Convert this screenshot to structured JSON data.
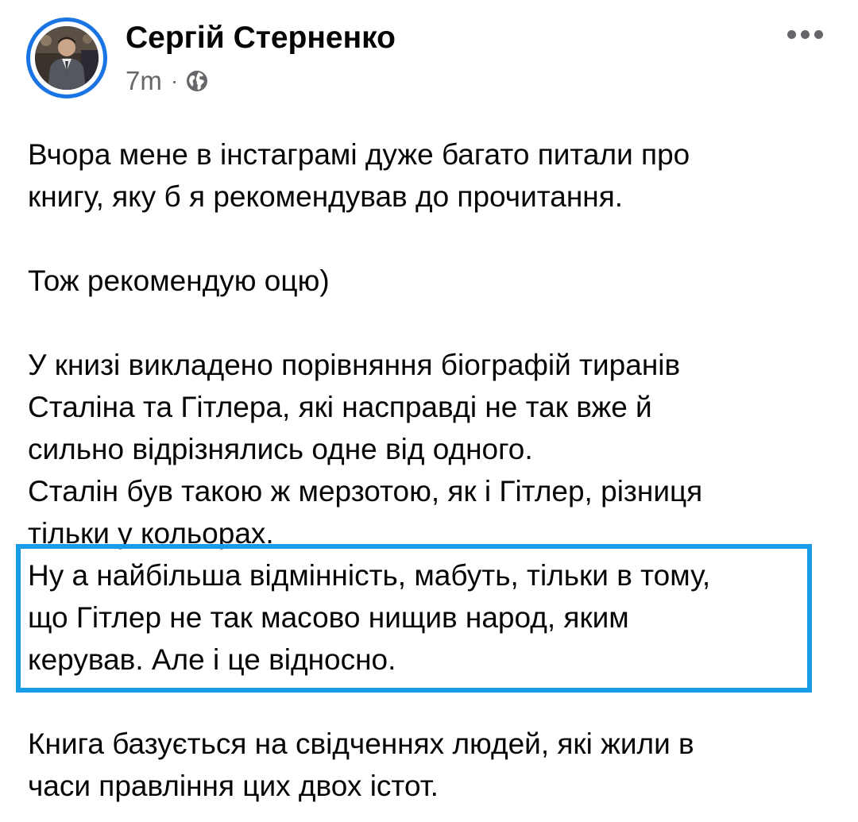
{
  "post": {
    "author": "Сергій Стерненко",
    "time": "7m",
    "separator": "·",
    "visibility_icon": "globe-icon",
    "more_icon": "more-options-icon",
    "paragraphs": [
      {
        "lines": [
          "Вчора мене в інстаграмі дуже багато питали про",
          "книгу, яку б я рекомендував до прочитання."
        ]
      },
      {
        "lines": [
          "Тож рекомендую оцю)"
        ]
      },
      {
        "lines": [
          "У книзі викладено порівняння біографій тиранів",
          "Сталіна та Гітлера, які насправді не так вже й",
          "сильно відрізнялись одне від одного.",
          "Сталін був такою ж мерзотою, як і Гітлер, різниця",
          "тільки у кольорах.",
          "Ну а найбільша відмінність, мабуть, тільки в тому,",
          "що Гітлер не так масово нищив народ, яким",
          "керував. Але і це відносно."
        ]
      },
      {
        "lines": [
          "Книга базується на свідченнях людей, які жили в",
          "часи правління цих двох істот."
        ]
      }
    ]
  },
  "colors": {
    "avatar_ring": "#1b74e4",
    "highlight_border": "#1a9be8",
    "secondary_text": "#65676b",
    "primary_text": "#050505"
  }
}
